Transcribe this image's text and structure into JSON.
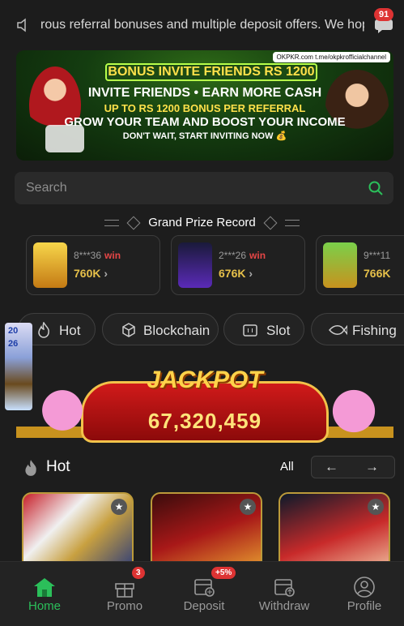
{
  "marquee": {
    "text": "rous referral bonuses and multiple deposit offers. We hop"
  },
  "messages": {
    "count": "91"
  },
  "banner": {
    "brand": "OKPKR.com   t.me/okpkrofficialchannel",
    "title": "BONUS INVITE FRIENDS RS 1200",
    "line1": "INVITE FRIENDS • EARN MORE CASH",
    "line2": "UP TO RS 1200 BONUS PER REFERRAL",
    "line3": "GROW YOUR TEAM AND BOOST YOUR INCOME",
    "line4": "DON'T WAIT, START INVITING NOW 💰",
    "dots_total": 13,
    "active_dot": 1
  },
  "search": {
    "placeholder": "Search"
  },
  "grand_prize": {
    "title": "Grand Prize Record",
    "records": [
      {
        "user": "8***36",
        "win": "win",
        "amount": "760K",
        "thumb_color": "#f2c83a"
      },
      {
        "user": "2***26",
        "win": "win",
        "amount": "676K",
        "thumb_color": "#4a2aa0"
      },
      {
        "user": "9***11",
        "win": "",
        "amount": "766K",
        "thumb_color": "#d2a020"
      }
    ]
  },
  "categories": [
    "Hot",
    "Blockchain",
    "Slot",
    "Fishing"
  ],
  "side_promo": {
    "line1": "20",
    "line2": "26"
  },
  "jackpot": {
    "title": "JACKPOT",
    "amount": "67,320,459"
  },
  "hot_section": {
    "title": "Hot",
    "all_label": "All",
    "prev": "←",
    "next": "→"
  },
  "tabbar": {
    "items": [
      {
        "label": "Home",
        "badge": ""
      },
      {
        "label": "Promo",
        "badge": "3"
      },
      {
        "label": "Deposit",
        "badge": "+5%"
      },
      {
        "label": "Withdraw",
        "badge": ""
      },
      {
        "label": "Profile",
        "badge": ""
      }
    ]
  },
  "colors": {
    "accent": "#2bbf5a",
    "badge": "#dd3333",
    "gold": "#e6c04a"
  }
}
